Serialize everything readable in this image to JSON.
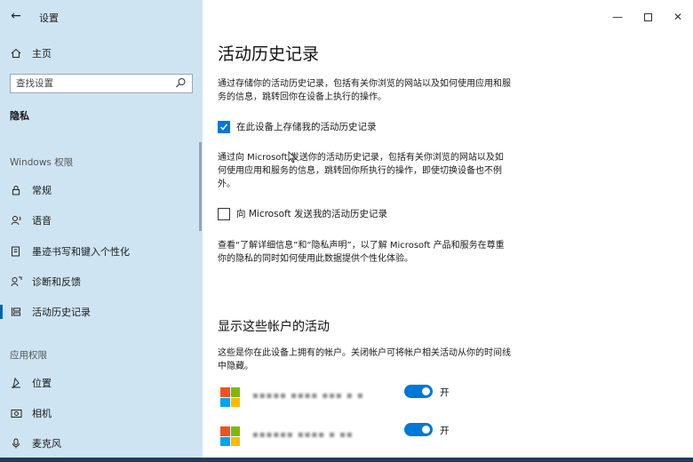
{
  "window": {
    "title": "设置"
  },
  "sidebar": {
    "home_label": "主页",
    "search_placeholder": "查找设置",
    "category": "隐私",
    "windows_permissions_label": "Windows 权限",
    "items": [
      {
        "label": "常规",
        "icon": "lock-icon"
      },
      {
        "label": "语音",
        "icon": "speech-icon"
      },
      {
        "label": "墨迹书写和键入个性化",
        "icon": "pen-note-icon"
      },
      {
        "label": "诊断和反馈",
        "icon": "feedback-icon"
      },
      {
        "label": "活动历史记录",
        "icon": "activity-icon",
        "active": true
      }
    ],
    "app_permissions_label": "应用权限",
    "app_items": [
      {
        "label": "位置",
        "icon": "location-icon"
      },
      {
        "label": "相机",
        "icon": "camera-icon"
      },
      {
        "label": "麦克风",
        "icon": "microphone-icon"
      }
    ]
  },
  "main": {
    "title": "活动历史记录",
    "intro": "通过存储你的活动历史记录，包括有关你浏览的网站以及如何使用应用和服务的信息，跳转回你在设备上执行的操作。",
    "store_checkbox": {
      "label": "在此设备上存储我的活动历史记录",
      "checked": true
    },
    "send_desc": "通过向 Microsoft 发送你的活动历史记录，包括有关你浏览的网站以及如何使用应用和服务的信息，跳转回你所执行的操作，即使切换设备也不例外。",
    "send_checkbox": {
      "label": "向 Microsoft 发送我的活动历史记录",
      "checked": false
    },
    "privacy_text": "查看“了解详细信息”和“隐私声明”，以了解 Microsoft 产品和服务在尊重你的隐私的同时如何使用此数据提供个性化体验。",
    "accounts_title": "显示这些帐户的活动",
    "accounts_desc": "这些是你在此设备上拥有的帐户。关闭帐户可将帐户相关活动从你的时间线中隐藏。",
    "accounts": [
      {
        "name": "▪▪▪▪▪ ▪▪▪▪ ▪▪▪ ▪ ▪",
        "toggle_label": "开",
        "on": true
      },
      {
        "name": "▪▪▪▪▪▪ ▪▪▪▪ ▪ ▪▪",
        "toggle_label": "开",
        "on": true
      }
    ]
  },
  "colors": {
    "accent": "#0078d7",
    "sidebar_bg": "#cfe4f3"
  }
}
